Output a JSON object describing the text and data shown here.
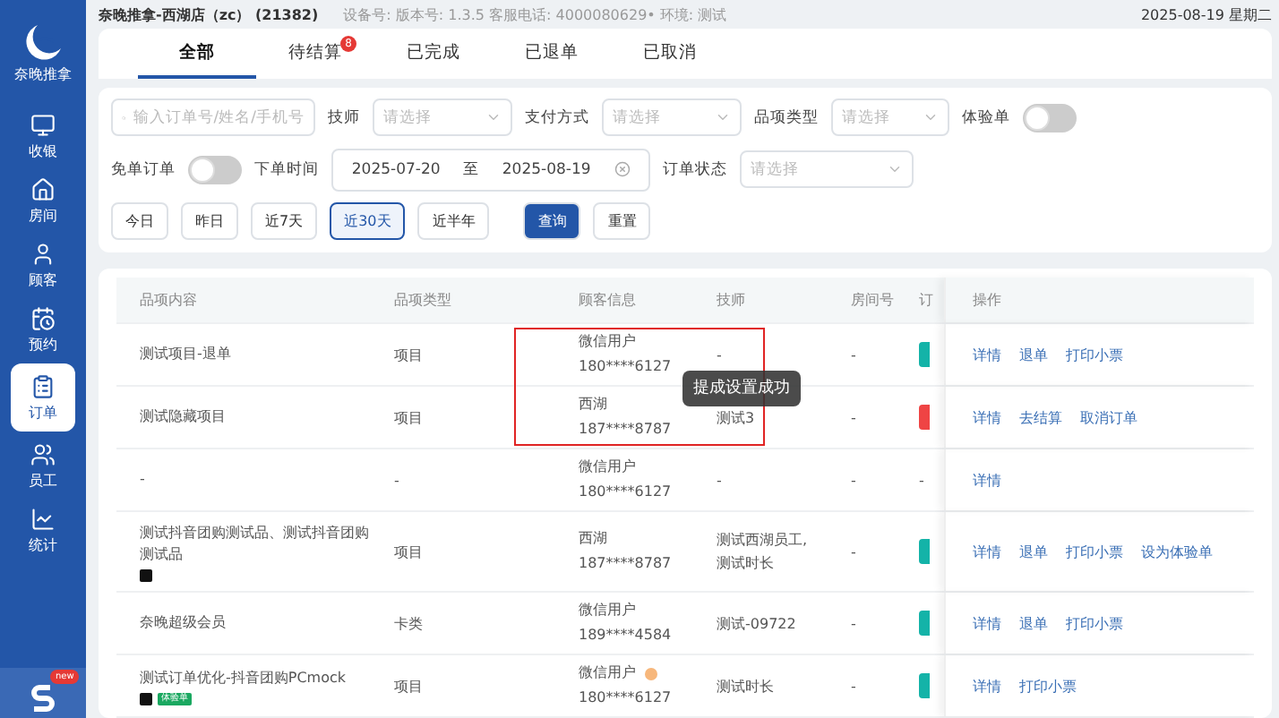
{
  "sidebar": {
    "logo_text": "奈晚推拿",
    "items": [
      {
        "label": "收银",
        "selected": false
      },
      {
        "label": "房间",
        "selected": false
      },
      {
        "label": "顾客",
        "selected": false
      },
      {
        "label": "预约",
        "selected": false
      },
      {
        "label": "订单",
        "selected": true
      },
      {
        "label": "员工",
        "selected": false
      },
      {
        "label": "统计",
        "selected": false
      }
    ],
    "bottom_badge": "new"
  },
  "header": {
    "store": "奈晚推拿-西湖店（zc） (21382)",
    "info": "设备号:  版本号:  1.3.5  客服电话:  4000080629•  环境:  测试",
    "date": "2025-08-19 星期二"
  },
  "tabs": [
    {
      "label": "全部",
      "selected": true
    },
    {
      "label": "待结算",
      "selected": false,
      "badge": "8"
    },
    {
      "label": "已完成",
      "selected": false
    },
    {
      "label": "已退单",
      "selected": false
    },
    {
      "label": "已取消",
      "selected": false
    }
  ],
  "filters": {
    "search_placeholder": "输入订单号/姓名/手机号",
    "technician_label": "技师",
    "technician_placeholder": "请选择",
    "payment_label": "支付方式",
    "payment_placeholder": "请选择",
    "category_label": "品项类型",
    "category_placeholder": "请选择",
    "trial_label": "体验单",
    "trial_on": false,
    "free_label": "免单订单",
    "free_on": false,
    "time_label": "下单时间",
    "date_from": "2025-07-20",
    "date_sep": "至",
    "date_to": "2025-08-19",
    "status_label": "订单状态",
    "status_placeholder": "请选择"
  },
  "quick_ranges": [
    {
      "label": "今日",
      "selected": false
    },
    {
      "label": "昨日",
      "selected": false
    },
    {
      "label": "近7天",
      "selected": false
    },
    {
      "label": "近30天",
      "selected": true
    },
    {
      "label": "近半年",
      "selected": false
    }
  ],
  "buttons": {
    "query": "查询",
    "reset": "重置"
  },
  "table": {
    "columns": [
      "品项内容",
      "品项类型",
      "顾客信息",
      "技师",
      "房间号",
      "订",
      "操作"
    ],
    "rows": [
      {
        "item": "测试项目-退单",
        "tiktok": false,
        "tag": null,
        "type": "项目",
        "customer": "微信用户",
        "phone": "180****6127",
        "customer_badge": false,
        "technician": "-",
        "room": "-",
        "color": "#14b3a8",
        "actions": [
          "详情",
          "退单",
          "打印小票"
        ]
      },
      {
        "item": "测试隐藏项目",
        "tiktok": false,
        "tag": null,
        "type": "项目",
        "customer": "西湖",
        "phone": "187****8787",
        "customer_badge": false,
        "technician": "测试3",
        "room": "-",
        "color": "#ef4444",
        "actions": [
          "详情",
          "去结算",
          "取消订单"
        ]
      },
      {
        "item": "-",
        "tiktok": false,
        "tag": null,
        "type": "-",
        "customer": "微信用户",
        "phone": "180****6127",
        "customer_badge": false,
        "technician": "-",
        "room": "-",
        "color": null,
        "status_text": "-",
        "actions": [
          "详情"
        ]
      },
      {
        "item": "测试抖音团购测试品、测试抖音团购测试品",
        "tiktok": true,
        "tag": null,
        "type": "项目",
        "customer": "西湖",
        "phone": "187****8787",
        "customer_badge": false,
        "technician": "测试西湖员工,\n测试时长",
        "room": "-",
        "color": "#14b3a8",
        "actions": [
          "详情",
          "退单",
          "打印小票",
          "设为体验单"
        ]
      },
      {
        "item": "奈晚超级会员",
        "tiktok": false,
        "tag": null,
        "type": "卡类",
        "customer": "微信用户",
        "phone": "189****4584",
        "customer_badge": false,
        "technician": "测试-09722",
        "room": "-",
        "color": "#14b3a8",
        "actions": [
          "详情",
          "退单",
          "打印小票"
        ]
      },
      {
        "item": "测试订单优化-抖音团购PCmock",
        "tiktok": true,
        "tag": "体验单",
        "type": "项目",
        "customer": "微信用户",
        "phone": "180****6127",
        "customer_badge": true,
        "technician": "测试时长",
        "room": "-",
        "color": "#14b3a8",
        "actions": [
          "详情",
          "打印小票"
        ]
      }
    ]
  },
  "toast": "提成设置成功"
}
